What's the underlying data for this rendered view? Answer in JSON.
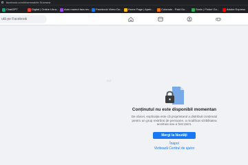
{
  "browser": {
    "url": "facebook.com/#/semnalele.Suceava"
  },
  "bookmarks": [
    {
      "label": "ChatGPT",
      "color": "#10a37f"
    },
    {
      "label": "Digital | Online Libra...",
      "color": "#ea4335"
    },
    {
      "label": "Auto mamut fara rec...",
      "color": "#a142f4"
    },
    {
      "label": "Facebook Video Do...",
      "color": "#1877f2"
    },
    {
      "label": "Home Page | Apeb...",
      "color": "#fbbc04"
    },
    {
      "label": "Colorado - Paid Gu...",
      "color": "#e8710a"
    },
    {
      "label": "Sonic | Picturi Gu...",
      "color": "#34a853"
    },
    {
      "label": "Adobe Express",
      "color": "#ff0000"
    }
  ],
  "header": {
    "search_placeholder": "ută pe Facebook"
  },
  "main": {
    "title": "Conținutul nu este disponibil momentan",
    "description": "De obicei, explicația este că proprietarul a distribuit conținutul pentru un grup restrâns de persoane, a modificat vizibilitatea acestuia sau a fost șters.",
    "button_label": "Mergi la Noutăți",
    "back_link": "Înapoi",
    "help_link": "Vizitează Centrul de ajutor"
  },
  "colors": {
    "accent": "#1877f2",
    "background": "#f0f2f5"
  }
}
